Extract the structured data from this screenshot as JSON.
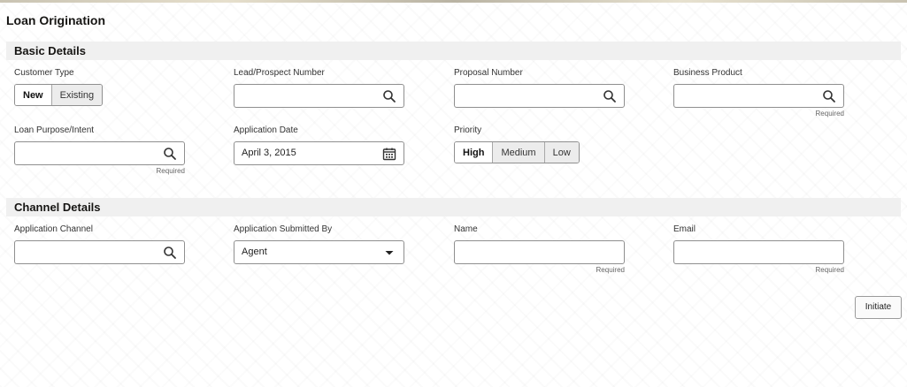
{
  "page": {
    "title": "Loan Origination"
  },
  "basic_details": {
    "header": "Basic Details",
    "customer_type": {
      "label": "Customer Type",
      "options": [
        "New",
        "Existing"
      ],
      "selected": "New"
    },
    "lead_prospect_number": {
      "label": "Lead/Prospect Number",
      "value": ""
    },
    "proposal_number": {
      "label": "Proposal Number",
      "value": ""
    },
    "business_product": {
      "label": "Business Product",
      "value": "",
      "hint": "Required"
    },
    "loan_purpose": {
      "label": "Loan Purpose/Intent",
      "value": "",
      "hint": "Required"
    },
    "application_date": {
      "label": "Application Date",
      "value": "April 3, 2015"
    },
    "priority": {
      "label": "Priority",
      "options": [
        "High",
        "Medium",
        "Low"
      ],
      "selected": "High"
    }
  },
  "channel_details": {
    "header": "Channel Details",
    "application_channel": {
      "label": "Application Channel",
      "value": ""
    },
    "submitted_by": {
      "label": "Application Submitted By",
      "value": "Agent"
    },
    "name": {
      "label": "Name",
      "value": "",
      "hint": "Required"
    },
    "email": {
      "label": "Email",
      "value": "",
      "hint": "Required"
    }
  },
  "actions": {
    "initiate_label": "Initiate"
  },
  "icons": {
    "search": "search-icon",
    "calendar": "calendar-icon",
    "dropdown": "caret-down-icon"
  }
}
